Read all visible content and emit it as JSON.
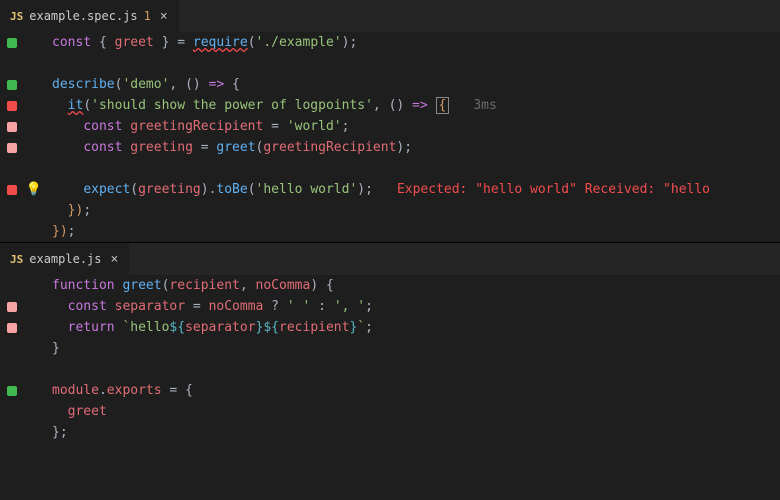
{
  "panes": {
    "top": {
      "tab": {
        "badge": "JS",
        "filename": "example.spec.js",
        "dirtyCount": "1",
        "close": "×"
      },
      "hints": {
        "testTime": "3ms",
        "errorText": "Expected: \"hello world\" Received: \"hello"
      },
      "code": {
        "l1": {
          "const": "const ",
          "brace_o": "{ ",
          "greet": "greet",
          "brace_c": " } ",
          "eq": "= ",
          "require": "require",
          "po": "(",
          "path": "'./example'",
          "pc": ")",
          "semi": ";"
        },
        "l3": {
          "describe": "describe",
          "po": "(",
          "name": "'demo'",
          "comma": ", ",
          "arrow_p": "()",
          "arrow": " => ",
          "brace": "{"
        },
        "l4": {
          "indent": "  ",
          "it": "it",
          "po": "(",
          "name": "'should show the power of logpoints'",
          "comma": ", ",
          "arrow_p": "()",
          "arrow": " => ",
          "brace": "{"
        },
        "l5": {
          "indent": "    ",
          "const": "const ",
          "var": "greetingRecipient",
          "eq": " = ",
          "val": "'world'",
          "semi": ";"
        },
        "l6": {
          "indent": "    ",
          "const": "const ",
          "var": "greeting",
          "eq": " = ",
          "fn": "greet",
          "po": "(",
          "arg": "greetingRecipient",
          "pc": ")",
          "semi": ";"
        },
        "l8": {
          "indent": "    ",
          "expect": "expect",
          "po": "(",
          "arg": "greeting",
          "pc": ")",
          "dot": ".",
          "tobe": "toBe",
          "po2": "(",
          "val": "'hello world'",
          "pc2": ")",
          "semi": ";"
        },
        "l9": {
          "indent": "  ",
          "close": "})",
          "semi": ";"
        },
        "l10": {
          "close": "})",
          "semi": ";"
        }
      }
    },
    "bottom": {
      "tab": {
        "badge": "JS",
        "filename": "example.js",
        "close": "×"
      },
      "code": {
        "l1": {
          "function": "function ",
          "name": "greet",
          "po": "(",
          "p1": "recipient",
          "comma": ", ",
          "p2": "noComma",
          "pc": ")",
          "brace": " {"
        },
        "l2": {
          "indent": "  ",
          "const": "const ",
          "var": "separator",
          "eq": " = ",
          "cond": "noComma",
          "q": " ? ",
          "v1": "' '",
          "colon": " : ",
          "v2": "', '",
          "semi": ";"
        },
        "l3": {
          "indent": "  ",
          "return": "return ",
          "bt1": "`",
          "txt": "hello",
          "io1": "${",
          "v1": "separator",
          "ic1": "}",
          "io2": "${",
          "v2": "recipient",
          "ic2": "}",
          "bt2": "`",
          "semi": ";"
        },
        "l4": {
          "close": "}"
        },
        "l6": {
          "mod": "module",
          "dot": ".",
          "exp": "exports",
          "eq": " = ",
          "brace": "{"
        },
        "l7": {
          "indent": "  ",
          "greet": "greet"
        },
        "l8": {
          "close": "}",
          "semi": ";"
        }
      }
    }
  }
}
